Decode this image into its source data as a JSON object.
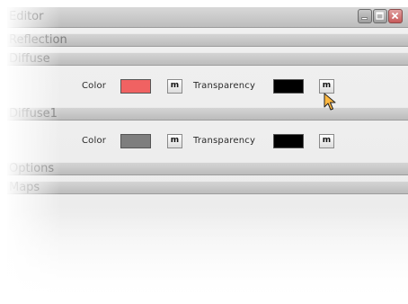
{
  "window": {
    "title": "Editor"
  },
  "sections": {
    "reflection": "Reflection",
    "diffuse": "Diffuse",
    "diffuse1": "Diffuse1",
    "options": "Options",
    "maps": "Maps"
  },
  "diffuse": {
    "color_label": "Color",
    "color_value": "#f06262",
    "color_map_button": "m",
    "transparency_label": "Transparency",
    "transparency_value": "#000000",
    "transparency_map_button": "m"
  },
  "diffuse1": {
    "color_label": "Color",
    "color_value": "#7e7e7e",
    "color_map_button": "m",
    "transparency_label": "Transparency",
    "transparency_value": "#000000",
    "transparency_map_button": "m"
  },
  "icons": {
    "minimize": "minimize-icon",
    "maximize": "maximize-icon",
    "close": "close-icon",
    "cursor": "mouse-pointer-icon"
  }
}
